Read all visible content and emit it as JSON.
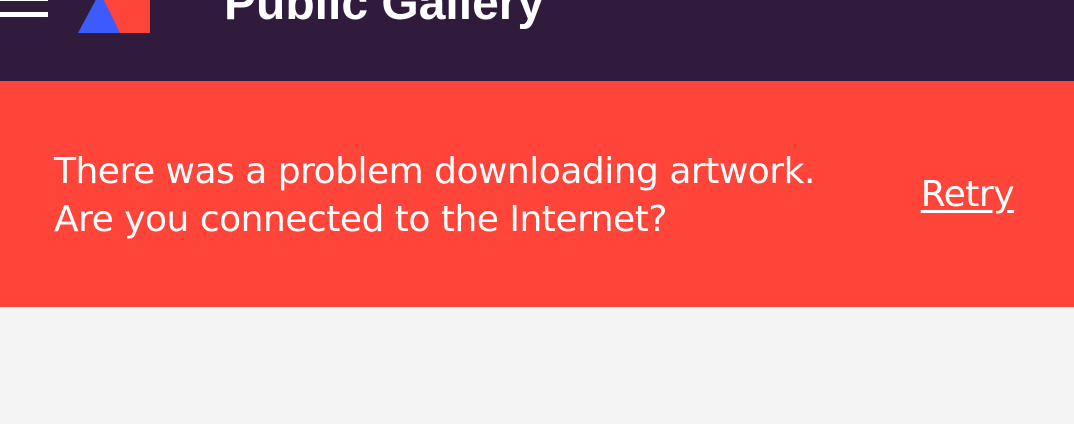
{
  "toolbar": {
    "title": "Public Gallery",
    "menu_icon": "hamburger-menu-icon",
    "logo_icon": "app-logo-icon",
    "background_color": "#311b3c"
  },
  "error_banner": {
    "message_line1": "There was a problem downloading artwork.",
    "message_line2": "Are you connected to the Internet?",
    "retry_label": "Retry",
    "background_color": "#ff4539"
  },
  "colors": {
    "logo_red": "#ff4539",
    "logo_blue": "#3d5afe",
    "content_background": "#f4f4f4"
  }
}
